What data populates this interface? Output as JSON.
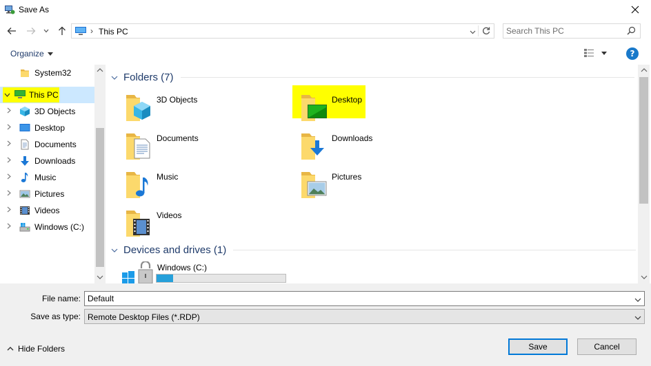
{
  "window": {
    "title": "Save As"
  },
  "address": {
    "path": "This PC",
    "separator": "›"
  },
  "search": {
    "placeholder": "Search This PC"
  },
  "toolbar": {
    "organize_label": "Organize",
    "help_label": "?"
  },
  "nav": {
    "items": [
      {
        "label": "System32",
        "icon": "folder-icon"
      },
      {
        "label": "This PC",
        "icon": "computer-icon",
        "selected": true,
        "expanded": true
      },
      {
        "label": "3D Objects",
        "icon": "3d-objects-icon"
      },
      {
        "label": "Desktop",
        "icon": "desktop-icon"
      },
      {
        "label": "Documents",
        "icon": "documents-icon"
      },
      {
        "label": "Downloads",
        "icon": "downloads-icon"
      },
      {
        "label": "Music",
        "icon": "music-icon"
      },
      {
        "label": "Pictures",
        "icon": "pictures-icon"
      },
      {
        "label": "Videos",
        "icon": "videos-icon"
      },
      {
        "label": "Windows (C:)",
        "icon": "drive-icon"
      }
    ]
  },
  "content": {
    "folders_header": "Folders (7)",
    "folders": [
      {
        "label": "3D Objects",
        "icon": "3d-objects-folder-icon"
      },
      {
        "label": "Desktop",
        "icon": "desktop-folder-icon"
      },
      {
        "label": "Documents",
        "icon": "documents-folder-icon"
      },
      {
        "label": "Downloads",
        "icon": "downloads-folder-icon"
      },
      {
        "label": "Music",
        "icon": "music-folder-icon"
      },
      {
        "label": "Pictures",
        "icon": "pictures-folder-icon"
      },
      {
        "label": "Videos",
        "icon": "videos-folder-icon"
      }
    ],
    "devices_header": "Devices and drives (1)",
    "drives": [
      {
        "label": "Windows (C:)",
        "icon": "windows-drive-icon",
        "used_fraction": 0.13
      }
    ]
  },
  "form": {
    "filename_label": "File name:",
    "filename_value": "Default",
    "savetype_label": "Save as type:",
    "savetype_value": "Remote Desktop Files (*.RDP)"
  },
  "footer": {
    "hide_folders_label": "Hide Folders",
    "save_label": "Save",
    "cancel_label": "Cancel"
  },
  "colors": {
    "accent": "#0078d7",
    "selection": "#cce8ff",
    "highlight": "#ffff00",
    "header_text": "#1e3a6a"
  }
}
